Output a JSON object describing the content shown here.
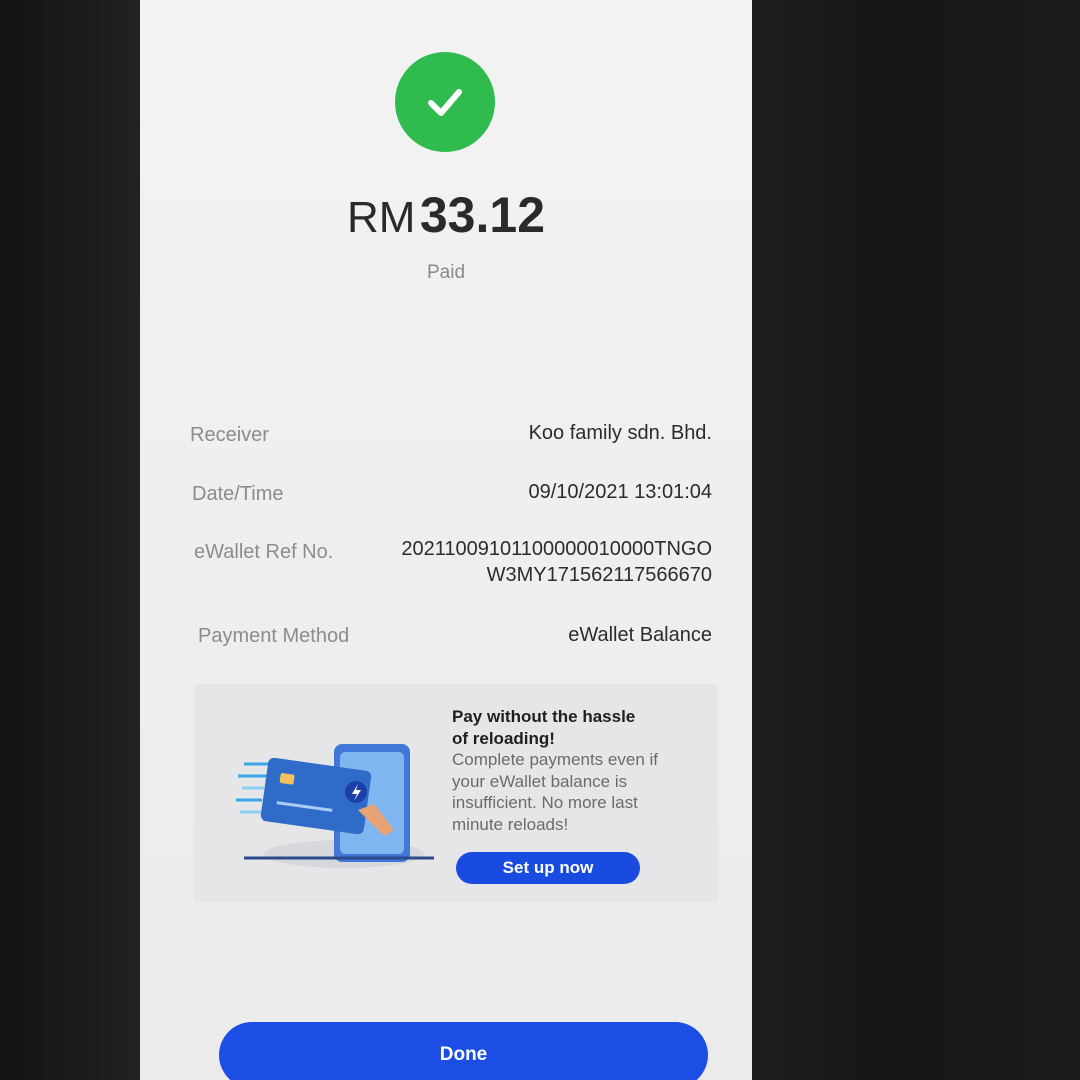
{
  "payment": {
    "currency": "RM",
    "amount": "33.12",
    "status": "Paid",
    "status_color": "#2fbb4e"
  },
  "details": {
    "receiver_label": "Receiver",
    "receiver_value": "Koo family sdn. Bhd.",
    "datetime_label": "Date/Time",
    "datetime_value": "09/10/2021 13:01:04",
    "ref_label": "eWallet Ref No.",
    "ref_value_line1": "20211009101100000010000TNGO",
    "ref_value_line2": "W3MY171562117566670",
    "method_label": "Payment Method",
    "method_value": "eWallet Balance"
  },
  "promo": {
    "title_line1": "Pay without the hassle",
    "title_line2": "of reloading!",
    "desc_line1": "Complete payments even if",
    "desc_line2": "your eWallet balance is",
    "desc_line3": "insufficient. No more last",
    "desc_line4": "minute reloads!",
    "cta_label": "Set up now",
    "illustration_icon": "card-phone-illustration"
  },
  "actions": {
    "done_label": "Done",
    "accent_color": "#1c4ee6"
  }
}
